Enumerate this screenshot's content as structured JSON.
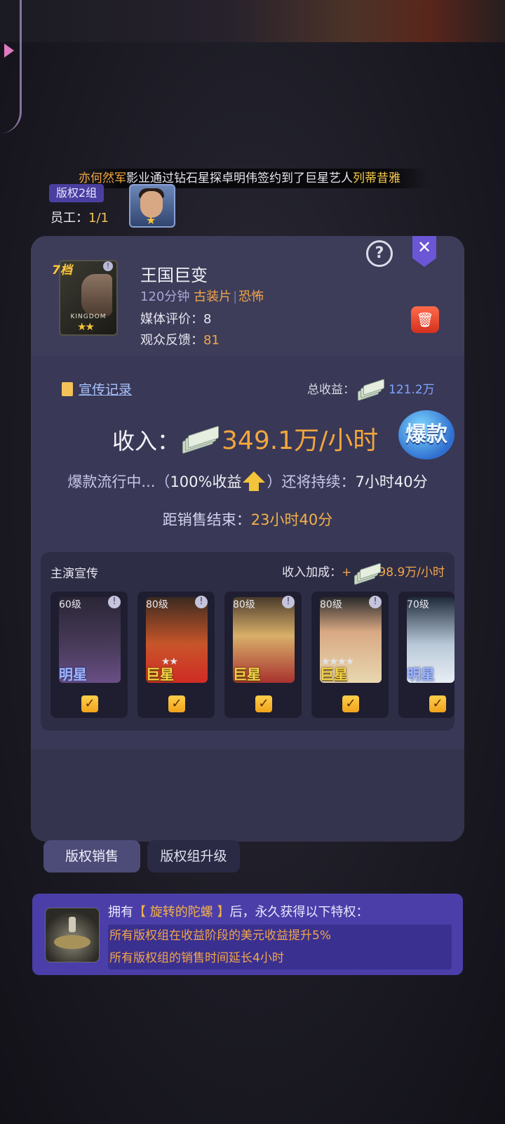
{
  "ticker": {
    "studio": "亦何然军",
    "middle": "影业通过钻石星探卓明伟签约到了巨星艺人",
    "artist": "列蒂昔雅"
  },
  "group": {
    "tag": "版权2组",
    "staff_label": "员工：",
    "staff_value": "1/1"
  },
  "movie": {
    "tier": "7档",
    "poster_text": "KINGDOM",
    "poster_stars": "★★",
    "title": "王国巨变",
    "duration": "120分钟",
    "genre1": "古装片",
    "separator": "|",
    "genre2": "恐怖",
    "media_label": "媒体评价：",
    "media_value": "8",
    "audience_label": "观众反馈：",
    "audience_value": "81"
  },
  "revenue": {
    "promo_link": "宣传记录",
    "total_label": "总收益：",
    "total_value": "121.2万",
    "income_label": "收入：",
    "income_value": "349.1万/小时",
    "hit_badge": "爆款",
    "boom_prefix": "爆款流行中...（",
    "boom_percent": "100%收益",
    "boom_suffix": "）还将持续：",
    "boom_remaining": "7小时40分",
    "sale_end_label": "距销售结束：",
    "sale_end_value": "23小时40分"
  },
  "cast": {
    "title": "主演宣传",
    "bonus_label": "收入加成：",
    "bonus_plus": "+",
    "bonus_value": "98.9万/小时",
    "cards": [
      {
        "level": "60级",
        "rank": "明星",
        "stars": "",
        "checked": true
      },
      {
        "level": "80级",
        "rank": "巨星",
        "stars": "★★",
        "checked": true
      },
      {
        "level": "80级",
        "rank": "巨星",
        "stars": "",
        "checked": true
      },
      {
        "level": "80级",
        "rank": "巨星",
        "stars": "★★★★",
        "checked": true
      },
      {
        "level": "70级",
        "rank": "明星",
        "stars": "",
        "checked": true
      }
    ]
  },
  "tabs": {
    "sales": "版权销售",
    "upgrade": "版权组升级"
  },
  "perk": {
    "head_prefix": "拥有",
    "item_name": "【 旋转的陀螺 】",
    "head_suffix": "后，永久获得以下特权：",
    "benefit1": "所有版权组在收益阶段的美元收益提升5%",
    "benefit2": "所有版权组的销售时间延长4小时"
  },
  "colors": {
    "accent_orange": "#f2a64a",
    "accent_purple": "#4b3ea8",
    "panel_bg": "#3e3d5a"
  }
}
